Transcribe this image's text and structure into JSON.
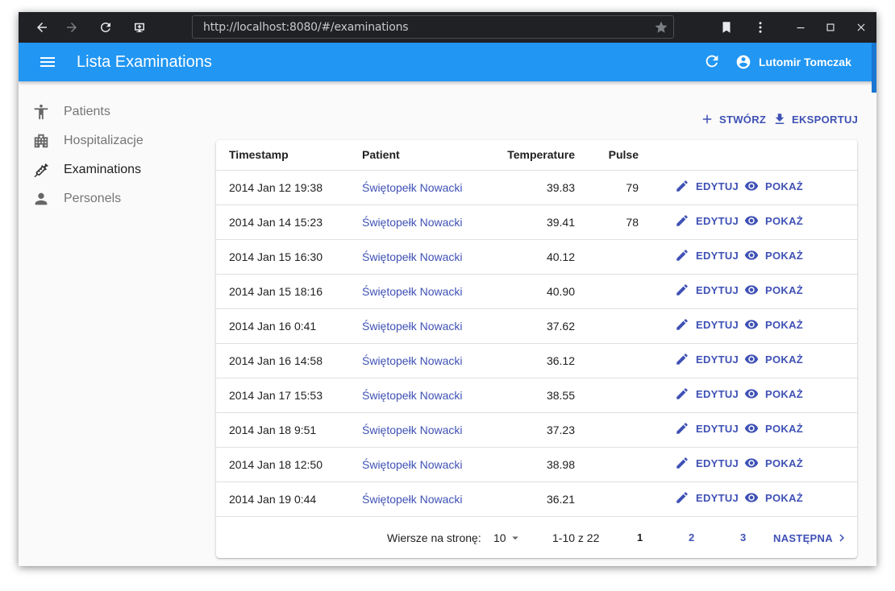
{
  "browser": {
    "url": "http://localhost:8080/#/examinations"
  },
  "appbar": {
    "title": "Lista Examinations",
    "user_name": "Lutomir Tomczak"
  },
  "sidebar": {
    "items": [
      {
        "label": "Patients",
        "icon": "accessibility-icon",
        "active": false
      },
      {
        "label": "Hospitalizacje",
        "icon": "hospital-building-icon",
        "active": false
      },
      {
        "label": "Examinations",
        "icon": "syringe-icon",
        "active": true
      },
      {
        "label": "Personels",
        "icon": "person-icon",
        "active": false
      }
    ]
  },
  "toolbar": {
    "create_label": "STWÓRZ",
    "export_label": "EKSPORTUJ"
  },
  "table": {
    "headers": {
      "timestamp": "Timestamp",
      "patient": "Patient",
      "temperature": "Temperature",
      "pulse": "Pulse"
    },
    "edit_label": "EDYTUJ",
    "show_label": "POKAŻ",
    "rows": [
      {
        "timestamp": "2014 Jan 12 19:38",
        "patient": "Świętopełk Nowacki",
        "temperature": "39.83",
        "pulse": "79"
      },
      {
        "timestamp": "2014 Jan 14 15:23",
        "patient": "Świętopełk Nowacki",
        "temperature": "39.41",
        "pulse": "78"
      },
      {
        "timestamp": "2014 Jan 15 16:30",
        "patient": "Świętopełk Nowacki",
        "temperature": "40.12",
        "pulse": ""
      },
      {
        "timestamp": "2014 Jan 15 18:16",
        "patient": "Świętopełk Nowacki",
        "temperature": "40.90",
        "pulse": ""
      },
      {
        "timestamp": "2014 Jan 16 0:41",
        "patient": "Świętopełk Nowacki",
        "temperature": "37.62",
        "pulse": ""
      },
      {
        "timestamp": "2014 Jan 16 14:58",
        "patient": "Świętopełk Nowacki",
        "temperature": "36.12",
        "pulse": ""
      },
      {
        "timestamp": "2014 Jan 17 15:53",
        "patient": "Świętopełk Nowacki",
        "temperature": "38.55",
        "pulse": ""
      },
      {
        "timestamp": "2014 Jan 18 9:51",
        "patient": "Świętopełk Nowacki",
        "temperature": "37.23",
        "pulse": ""
      },
      {
        "timestamp": "2014 Jan 18 12:50",
        "patient": "Świętopełk Nowacki",
        "temperature": "38.98",
        "pulse": ""
      },
      {
        "timestamp": "2014 Jan 19 0:44",
        "patient": "Świętopełk Nowacki",
        "temperature": "36.21",
        "pulse": ""
      }
    ]
  },
  "pagination": {
    "rows_per_page_label": "Wiersze na stronę:",
    "rows_per_page": "10",
    "range": "1-10 z 22",
    "pages": [
      "1",
      "2",
      "3"
    ],
    "current_page": "1",
    "next_label": "NASTĘPNA"
  },
  "colors": {
    "appbar": "#2196f3",
    "accent": "#3f51b5"
  }
}
